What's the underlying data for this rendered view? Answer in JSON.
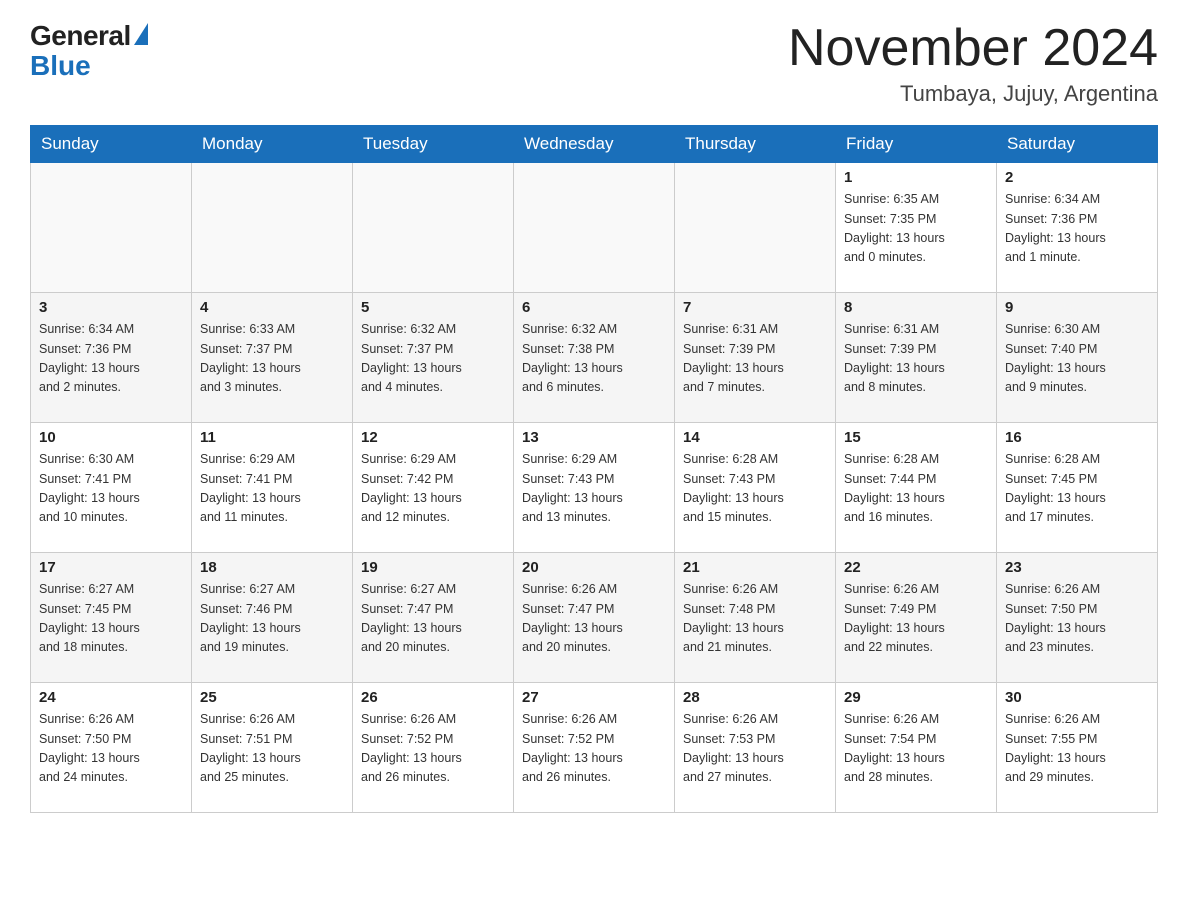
{
  "logo": {
    "general": "General",
    "blue": "Blue"
  },
  "header": {
    "month_year": "November 2024",
    "location": "Tumbaya, Jujuy, Argentina"
  },
  "days_of_week": [
    "Sunday",
    "Monday",
    "Tuesday",
    "Wednesday",
    "Thursday",
    "Friday",
    "Saturday"
  ],
  "weeks": [
    [
      {
        "day": "",
        "info": ""
      },
      {
        "day": "",
        "info": ""
      },
      {
        "day": "",
        "info": ""
      },
      {
        "day": "",
        "info": ""
      },
      {
        "day": "",
        "info": ""
      },
      {
        "day": "1",
        "info": "Sunrise: 6:35 AM\nSunset: 7:35 PM\nDaylight: 13 hours\nand 0 minutes."
      },
      {
        "day": "2",
        "info": "Sunrise: 6:34 AM\nSunset: 7:36 PM\nDaylight: 13 hours\nand 1 minute."
      }
    ],
    [
      {
        "day": "3",
        "info": "Sunrise: 6:34 AM\nSunset: 7:36 PM\nDaylight: 13 hours\nand 2 minutes."
      },
      {
        "day": "4",
        "info": "Sunrise: 6:33 AM\nSunset: 7:37 PM\nDaylight: 13 hours\nand 3 minutes."
      },
      {
        "day": "5",
        "info": "Sunrise: 6:32 AM\nSunset: 7:37 PM\nDaylight: 13 hours\nand 4 minutes."
      },
      {
        "day": "6",
        "info": "Sunrise: 6:32 AM\nSunset: 7:38 PM\nDaylight: 13 hours\nand 6 minutes."
      },
      {
        "day": "7",
        "info": "Sunrise: 6:31 AM\nSunset: 7:39 PM\nDaylight: 13 hours\nand 7 minutes."
      },
      {
        "day": "8",
        "info": "Sunrise: 6:31 AM\nSunset: 7:39 PM\nDaylight: 13 hours\nand 8 minutes."
      },
      {
        "day": "9",
        "info": "Sunrise: 6:30 AM\nSunset: 7:40 PM\nDaylight: 13 hours\nand 9 minutes."
      }
    ],
    [
      {
        "day": "10",
        "info": "Sunrise: 6:30 AM\nSunset: 7:41 PM\nDaylight: 13 hours\nand 10 minutes."
      },
      {
        "day": "11",
        "info": "Sunrise: 6:29 AM\nSunset: 7:41 PM\nDaylight: 13 hours\nand 11 minutes."
      },
      {
        "day": "12",
        "info": "Sunrise: 6:29 AM\nSunset: 7:42 PM\nDaylight: 13 hours\nand 12 minutes."
      },
      {
        "day": "13",
        "info": "Sunrise: 6:29 AM\nSunset: 7:43 PM\nDaylight: 13 hours\nand 13 minutes."
      },
      {
        "day": "14",
        "info": "Sunrise: 6:28 AM\nSunset: 7:43 PM\nDaylight: 13 hours\nand 15 minutes."
      },
      {
        "day": "15",
        "info": "Sunrise: 6:28 AM\nSunset: 7:44 PM\nDaylight: 13 hours\nand 16 minutes."
      },
      {
        "day": "16",
        "info": "Sunrise: 6:28 AM\nSunset: 7:45 PM\nDaylight: 13 hours\nand 17 minutes."
      }
    ],
    [
      {
        "day": "17",
        "info": "Sunrise: 6:27 AM\nSunset: 7:45 PM\nDaylight: 13 hours\nand 18 minutes."
      },
      {
        "day": "18",
        "info": "Sunrise: 6:27 AM\nSunset: 7:46 PM\nDaylight: 13 hours\nand 19 minutes."
      },
      {
        "day": "19",
        "info": "Sunrise: 6:27 AM\nSunset: 7:47 PM\nDaylight: 13 hours\nand 20 minutes."
      },
      {
        "day": "20",
        "info": "Sunrise: 6:26 AM\nSunset: 7:47 PM\nDaylight: 13 hours\nand 20 minutes."
      },
      {
        "day": "21",
        "info": "Sunrise: 6:26 AM\nSunset: 7:48 PM\nDaylight: 13 hours\nand 21 minutes."
      },
      {
        "day": "22",
        "info": "Sunrise: 6:26 AM\nSunset: 7:49 PM\nDaylight: 13 hours\nand 22 minutes."
      },
      {
        "day": "23",
        "info": "Sunrise: 6:26 AM\nSunset: 7:50 PM\nDaylight: 13 hours\nand 23 minutes."
      }
    ],
    [
      {
        "day": "24",
        "info": "Sunrise: 6:26 AM\nSunset: 7:50 PM\nDaylight: 13 hours\nand 24 minutes."
      },
      {
        "day": "25",
        "info": "Sunrise: 6:26 AM\nSunset: 7:51 PM\nDaylight: 13 hours\nand 25 minutes."
      },
      {
        "day": "26",
        "info": "Sunrise: 6:26 AM\nSunset: 7:52 PM\nDaylight: 13 hours\nand 26 minutes."
      },
      {
        "day": "27",
        "info": "Sunrise: 6:26 AM\nSunset: 7:52 PM\nDaylight: 13 hours\nand 26 minutes."
      },
      {
        "day": "28",
        "info": "Sunrise: 6:26 AM\nSunset: 7:53 PM\nDaylight: 13 hours\nand 27 minutes."
      },
      {
        "day": "29",
        "info": "Sunrise: 6:26 AM\nSunset: 7:54 PM\nDaylight: 13 hours\nand 28 minutes."
      },
      {
        "day": "30",
        "info": "Sunrise: 6:26 AM\nSunset: 7:55 PM\nDaylight: 13 hours\nand 29 minutes."
      }
    ]
  ]
}
